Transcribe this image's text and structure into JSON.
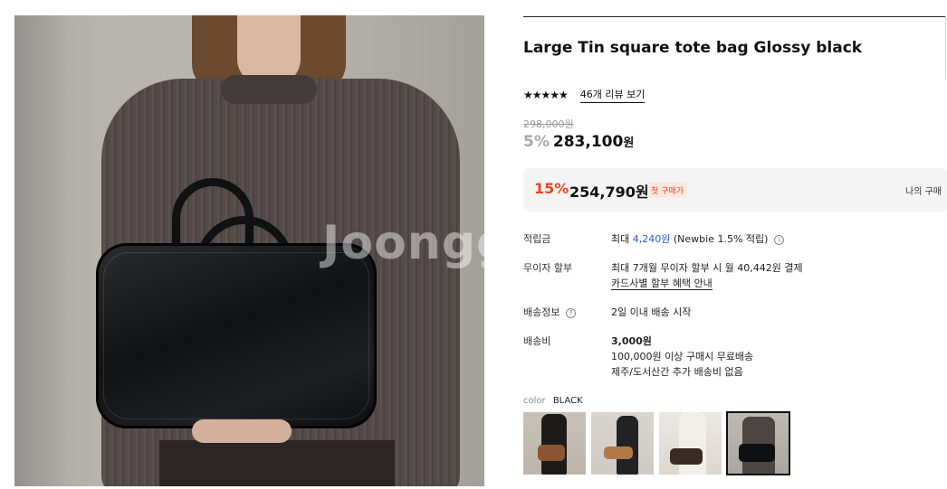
{
  "product": {
    "title": "Large Tin square tote bag Glossy black",
    "stars": "★★★★★",
    "review_link": "46개 리뷰 보기",
    "original_price": "298,000원",
    "sale_rate": "5%",
    "sale_price": "283,100",
    "sale_unit": "원",
    "rating": 4.5
  },
  "coupon": {
    "rate": "15%",
    "price": "254,790원",
    "badge": "첫 구매가",
    "my_price_label": "나의 구매"
  },
  "details": {
    "points_label": "적립금",
    "points_prefix": "최대",
    "points_amount": "4,240원",
    "points_suffix": "(Newbie 1.5% 적립)",
    "installment_label": "무이자 할부",
    "installment_text": "최대 7개월 무이자 할부 시 월 40,442원 결제",
    "installment_link": "카드사별 할부 혜택 안내",
    "delivery_info_label": "배송정보",
    "delivery_info_text": "2일 이내 배송 시작",
    "shipping_fee_label": "배송비",
    "shipping_fee": "3,000원",
    "shipping_free_text": "100,000원 이상 구매시 무료배송",
    "shipping_island_text": "제주/도서산간 추가 배송비 없음"
  },
  "color": {
    "label": "color",
    "value": "BLACK"
  },
  "watermark": "Joongg",
  "icons": {
    "help": "help-circle-icon",
    "info": "info-circle-icon"
  },
  "colors": {
    "discount": "#f0421f",
    "link_blue": "#2b5bd7",
    "muted": "#a9a9a9"
  }
}
